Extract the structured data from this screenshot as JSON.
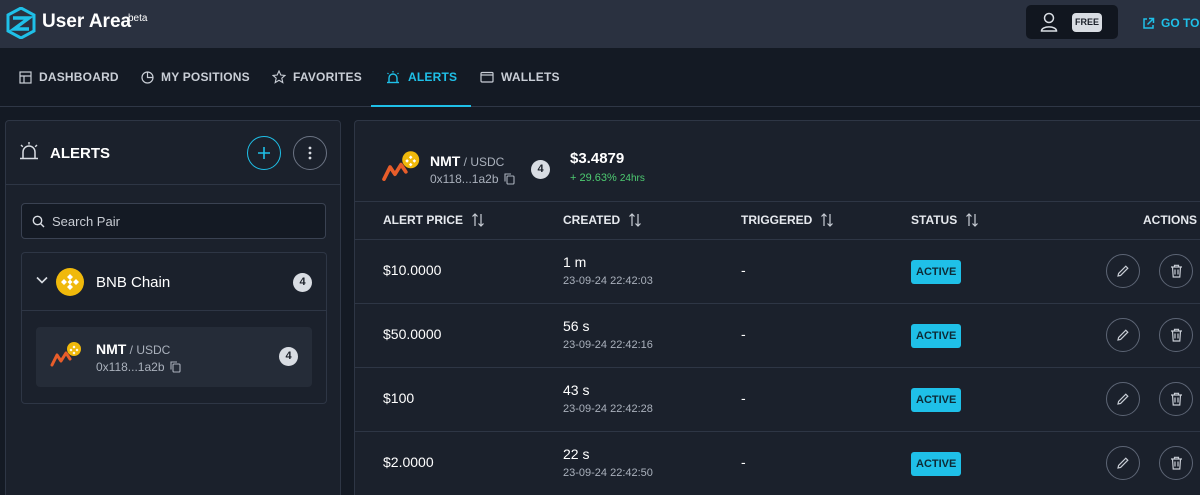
{
  "app": {
    "title": "User Area",
    "badge": "beta",
    "plan": "FREE",
    "goto_label": "GO TO..."
  },
  "tabs": [
    {
      "label": "DASHBOARD",
      "icon": "dashboard-icon",
      "active": false
    },
    {
      "label": "MY POSITIONS",
      "icon": "pie-chart-icon",
      "active": false
    },
    {
      "label": "FAVORITES",
      "icon": "star-icon",
      "active": false
    },
    {
      "label": "ALERTS",
      "icon": "siren-icon",
      "active": true
    },
    {
      "label": "WALLETS",
      "icon": "wallet-icon",
      "active": false
    }
  ],
  "sidebar": {
    "title": "ALERTS",
    "search_placeholder": "Search Pair",
    "chain": {
      "name": "BNB Chain",
      "count": "4"
    },
    "pair": {
      "symbol": "NMT",
      "quote": " / USDC",
      "address": "0x118...1a2b",
      "count": "4"
    }
  },
  "detail": {
    "symbol": "NMT",
    "quote": " / USDC",
    "address": "0x118...1a2b",
    "count": "4",
    "price": "$3.4879",
    "change": "+ 29.63%",
    "change_period": "24hrs"
  },
  "table": {
    "headers": {
      "alert_price": "ALERT PRICE",
      "created": "CREATED",
      "triggered": "TRIGGERED",
      "status": "STATUS",
      "actions": "ACTIONS"
    },
    "rows": [
      {
        "alert_price": "$10.0000",
        "created": "1 m",
        "created_date": "23-09-24 22:42:03",
        "triggered": "-",
        "status": "ACTIVE"
      },
      {
        "alert_price": "$50.0000",
        "created": "56 s",
        "created_date": "23-09-24 22:42:16",
        "triggered": "-",
        "status": "ACTIVE"
      },
      {
        "alert_price": "$100",
        "created": "43 s",
        "created_date": "23-09-24 22:42:28",
        "triggered": "-",
        "status": "ACTIVE"
      },
      {
        "alert_price": "$2.0000",
        "created": "22 s",
        "created_date": "23-09-24 22:42:50",
        "triggered": "-",
        "status": "ACTIVE"
      }
    ]
  },
  "colors": {
    "accent": "#1fc0e8",
    "positive": "#4ecb71",
    "background": "#141a24",
    "panel": "#1b212c"
  }
}
